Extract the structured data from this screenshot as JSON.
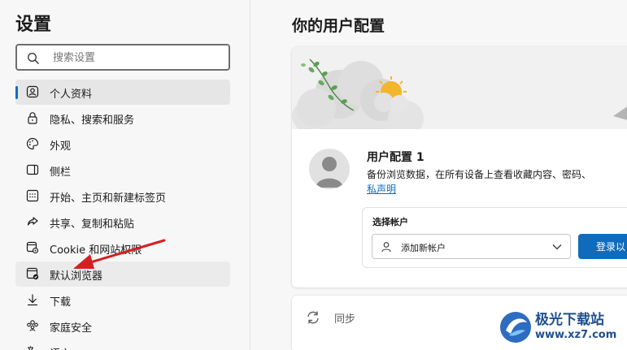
{
  "sidebar": {
    "title": "设置",
    "search_placeholder": "搜索设置",
    "items": [
      {
        "label": "个人资料",
        "icon": "profile-icon"
      },
      {
        "label": "隐私、搜索和服务",
        "icon": "lock-icon"
      },
      {
        "label": "外观",
        "icon": "palette-icon"
      },
      {
        "label": "侧栏",
        "icon": "sidebar-icon"
      },
      {
        "label": "开始、主页和新建标签页",
        "icon": "home-grid-icon"
      },
      {
        "label": "共享、复制和粘贴",
        "icon": "share-icon"
      },
      {
        "label": "Cookie 和网站权限",
        "icon": "cookie-settings-icon"
      },
      {
        "label": "默认浏览器",
        "icon": "default-browser-icon"
      },
      {
        "label": "下载",
        "icon": "download-icon"
      },
      {
        "label": "家庭安全",
        "icon": "family-icon"
      },
      {
        "label": "语言",
        "icon": "language-icon"
      }
    ]
  },
  "main": {
    "title": "你的用户配置",
    "profile": {
      "name": "用户配置 1",
      "desc": "备份浏览数据，在所有设备上查看收藏内容、密码、",
      "link": "私声明"
    },
    "account": {
      "label": "选择帐户",
      "select_value": "添加新帐户",
      "signin_label": "登录以"
    },
    "sync": {
      "label": "同步"
    }
  },
  "watermark": {
    "name": "极光下载站",
    "url": "www.xz7.com"
  },
  "colors": {
    "accent": "#0f6cbd",
    "annotation": "#d42020"
  }
}
